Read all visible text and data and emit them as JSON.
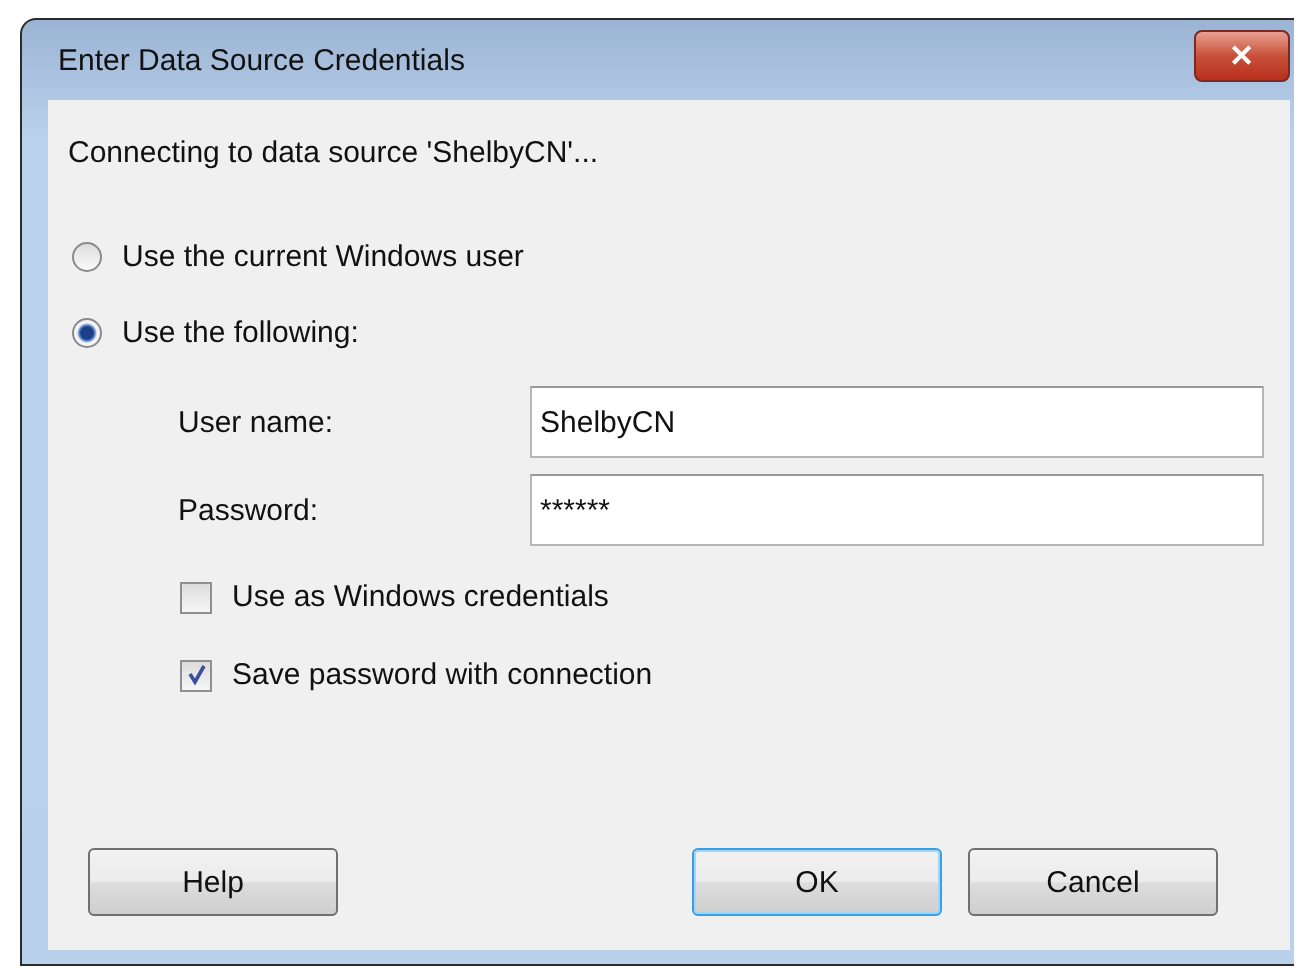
{
  "window": {
    "title": "Enter Data Source Credentials",
    "close": "✕"
  },
  "message": "Connecting to data source 'ShelbyCN'...",
  "options": [
    {
      "label": "Use the current Windows user",
      "selected": false
    },
    {
      "label": "Use the following:",
      "selected": true
    }
  ],
  "fields": [
    {
      "label": "User name:",
      "value": "ShelbyCN"
    },
    {
      "label": "Password:",
      "value": "******"
    }
  ],
  "checkboxes": [
    {
      "label": "Use as Windows credentials",
      "checked": false
    },
    {
      "label": "Save password with connection",
      "checked": true
    }
  ],
  "buttons": [
    {
      "label": "Help",
      "default": false
    },
    {
      "label": "OK",
      "default": true
    },
    {
      "label": "Cancel",
      "default": false
    }
  ]
}
